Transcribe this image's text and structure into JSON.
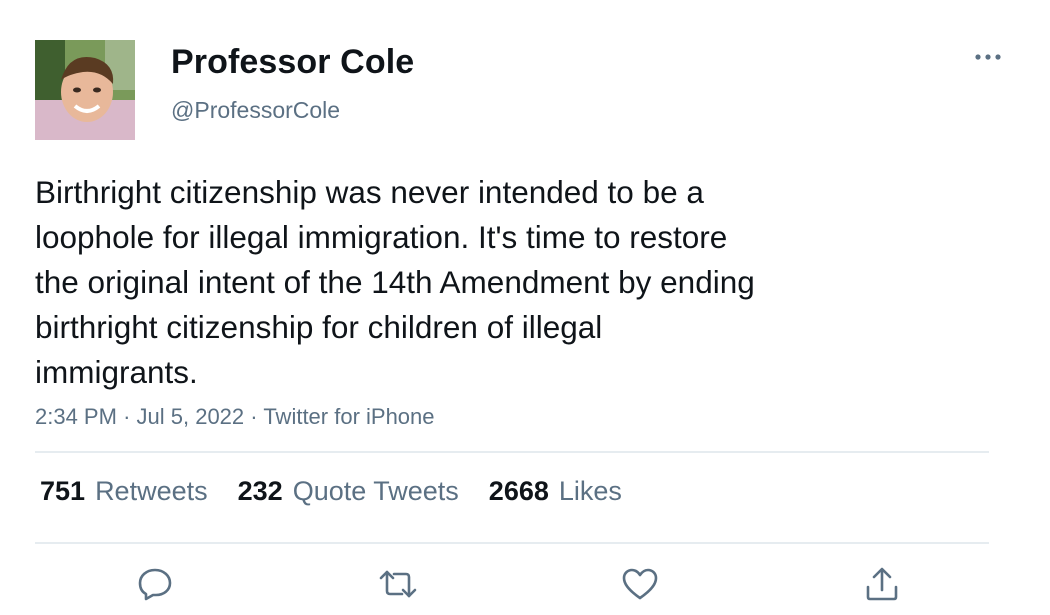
{
  "author": {
    "display_name": "Professor Cole",
    "handle": "@ProfessorCole"
  },
  "tweet": {
    "text": "Birthright citizenship was never intended to be a\nloophole for illegal immigration. It's time to restore\nthe original intent of the 14th Amendment by ending\nbirthright citizenship for children of illegal\nimmigrants.",
    "time": "2:34 PM",
    "date": "Jul 5, 2022",
    "source": "Twitter for iPhone",
    "separator": "·"
  },
  "stats": {
    "retweets_count": "751",
    "retweets_label": "Retweets",
    "quote_tweets_count": "232",
    "quote_tweets_label": "Quote Tweets",
    "likes_count": "2668",
    "likes_label": "Likes"
  },
  "icons": {
    "more": "more-horizontal-icon",
    "reply": "reply-icon",
    "retweet": "retweet-icon",
    "like": "heart-icon",
    "share": "share-icon"
  },
  "colors": {
    "text": "#0f1419",
    "secondary": "#5b7083",
    "divider": "#e6ecf0"
  }
}
